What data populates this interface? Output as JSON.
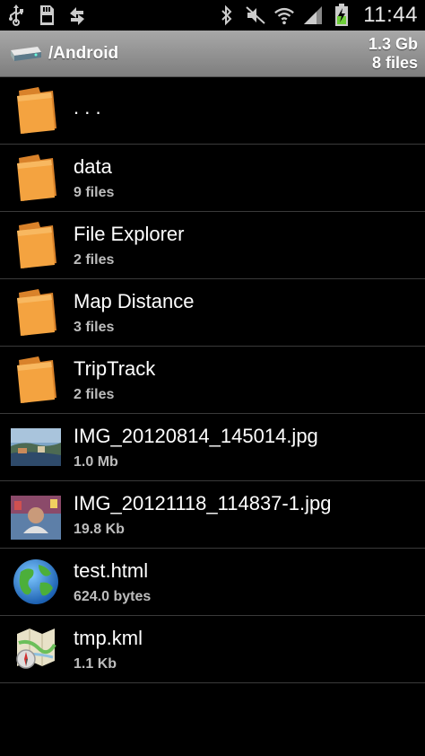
{
  "status_bar": {
    "time": "11:44",
    "left_icons": [
      "usb-icon",
      "sd-card-icon",
      "sync-icon"
    ],
    "right_icons": [
      "bluetooth-icon",
      "mute-icon",
      "wifi-icon",
      "signal-icon",
      "battery-charging-icon"
    ]
  },
  "header": {
    "path": "/Android",
    "size": "1.3 Gb",
    "count": "8 files",
    "icon": "drive-icon"
  },
  "files": [
    {
      "name": ". . .",
      "sub": "",
      "icon": "folder-icon"
    },
    {
      "name": "data",
      "sub": "9 files",
      "icon": "folder-icon"
    },
    {
      "name": "File Explorer",
      "sub": "2 files",
      "icon": "folder-icon"
    },
    {
      "name": "Map Distance",
      "sub": "3 files",
      "icon": "folder-icon"
    },
    {
      "name": "TripTrack",
      "sub": "2 files",
      "icon": "folder-icon"
    },
    {
      "name": "IMG_20120814_145014.jpg",
      "sub": "1.0 Mb",
      "icon": "image-thumbnail-icon"
    },
    {
      "name": "IMG_20121118_114837-1.jpg",
      "sub": "19.8 Kb",
      "icon": "image-thumbnail-icon"
    },
    {
      "name": "test.html",
      "sub": "624.0 bytes",
      "icon": "globe-icon"
    },
    {
      "name": "tmp.kml",
      "sub": "1.1 Kb",
      "icon": "map-icon"
    }
  ],
  "colors": {
    "background": "#000000",
    "folder": "#f4a340",
    "header_bar": "#8f8f8f",
    "divider": "#3a3a3a",
    "subtext": "#bdbdbd"
  }
}
